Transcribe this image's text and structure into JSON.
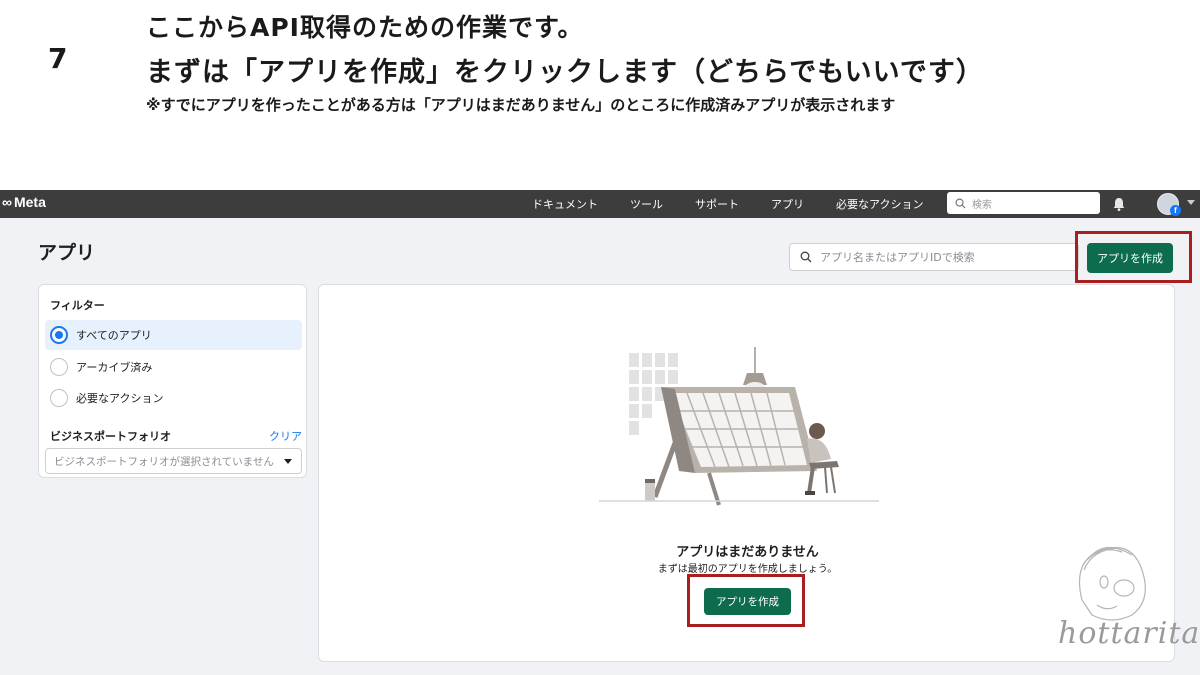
{
  "caption": {
    "step_number": "7",
    "line1": "ここからAPI取得のための作業です。",
    "line2": "まずは「アプリを作成」をクリックします（どちらでもいいです）",
    "note": "※すでにアプリを作ったことがある方は「アプリはまだありません」のところに作成済みアプリが表示されます"
  },
  "topnav": {
    "logo": "Meta",
    "links": [
      "ドキュメント",
      "ツール",
      "サポート",
      "アプリ",
      "必要なアクション"
    ],
    "search_placeholder": "検索"
  },
  "page": {
    "title": "アプリ",
    "search_placeholder": "アプリ名またはアプリIDで検索",
    "create_button": "アプリを作成"
  },
  "filters": {
    "title": "フィルター",
    "options": [
      {
        "label": "すべてのアプリ",
        "selected": true
      },
      {
        "label": "アーカイブ済み",
        "selected": false
      },
      {
        "label": "必要なアクション",
        "selected": false
      }
    ],
    "business_portfolio_label": "ビジネスポートフォリオ",
    "clear_link": "クリア",
    "business_portfolio_placeholder": "ビジネスポートフォリオが選択されていません"
  },
  "empty_state": {
    "title": "アプリはまだありません",
    "subtitle": "まずは最初のアプリを作成しましょう。",
    "create_button": "アプリを作成"
  },
  "watermark": {
    "text": "hottarita"
  },
  "colors": {
    "nav_bg": "#3d3d3d",
    "primary_button": "#0d6b4e",
    "highlight_box": "#a7201f",
    "link_blue": "#1877f2"
  }
}
